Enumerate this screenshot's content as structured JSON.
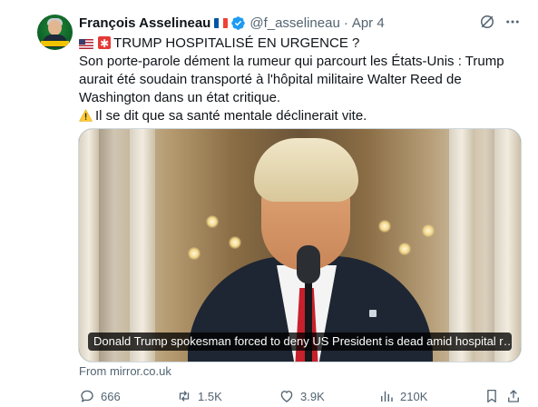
{
  "author": {
    "name": "François Asselineau",
    "handle": "@f_asselineau",
    "date": "Apr 4"
  },
  "tweet": {
    "line1": "TRUMP HOSPITALISÉ EN URGENCE ?",
    "line2": "Son porte-parole dément la rumeur qui parcourt les États-Unis : Trump",
    "line3": "aurait été soudain transporté à l'hôpital militaire Walter Reed de",
    "line4": "Washington dans un état critique.",
    "line5": "Il se dit que sa santé mentale déclinerait vite.",
    "emojis": [
      "us-flag-icon",
      "red-asterisk-icon",
      "warning-icon"
    ]
  },
  "media": {
    "caption": "Donald Trump spokesman forced to deny US President is dead amid hospital r…",
    "source": "From mirror.co.uk"
  },
  "actions": {
    "replies": "666",
    "reposts": "1.5K",
    "likes": "3.9K",
    "views": "210K"
  },
  "colors": {
    "text": "#0f1419",
    "secondary": "#536471",
    "verified": "#1d9bf0",
    "border": "#cfd9de"
  }
}
